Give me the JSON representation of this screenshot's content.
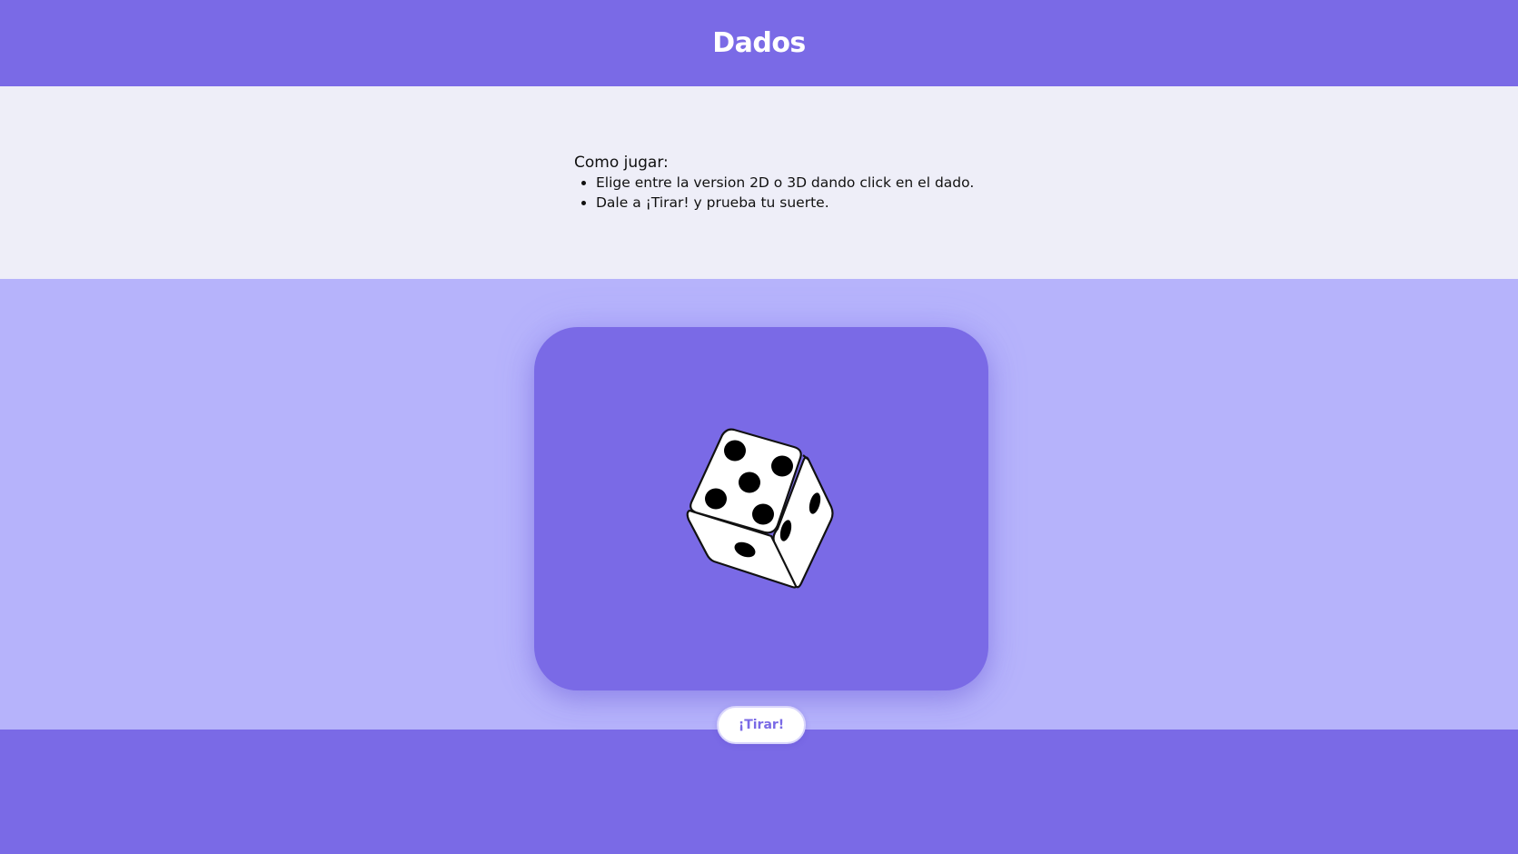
{
  "header": {
    "title": "Dados"
  },
  "instructions": {
    "title": "Como jugar:",
    "items": [
      "Elige entre la version 2D o 3D dando click en el dado.",
      "Dale a ¡Tirar! y prueba tu suerte."
    ]
  },
  "dice": {
    "mode": "3D",
    "top_face_value": 5,
    "front_face_value": 1,
    "right_face_value": 2
  },
  "controls": {
    "roll_label": "¡Tirar!"
  },
  "colors": {
    "primary": "#7a6ae6",
    "game_background": "#b6b3fb",
    "instructions_background": "#eeeef8",
    "button_background": "#ffffff"
  }
}
